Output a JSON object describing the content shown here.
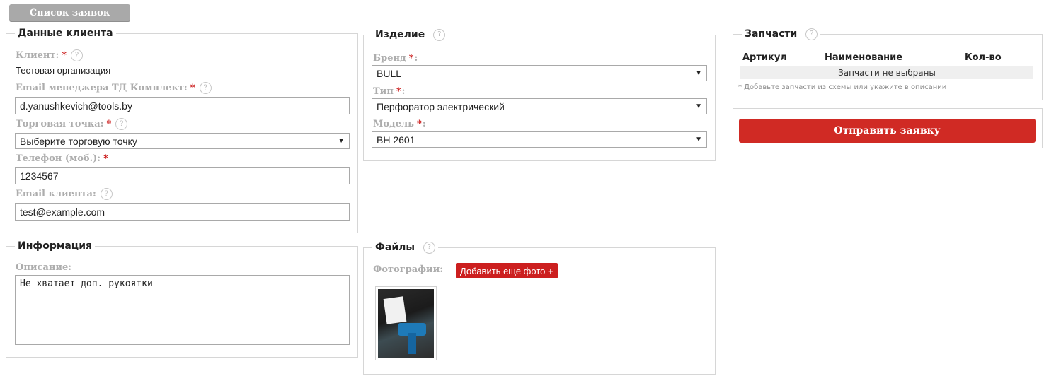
{
  "top_button": "Список заявок",
  "client": {
    "legend": "Данные клиента",
    "client_label": "Клиент:",
    "client_value": "Тестовая организация",
    "manager_email_label": "Email менеджера ТД Комплект:",
    "manager_email_value": "d.yanushkevich@tools.by",
    "point_label": "Торговая точка:",
    "point_value": "Выберите торговую точку",
    "phone_label": "Телефон (моб.):",
    "phone_value": "1234567",
    "client_email_label": "Email клиента:",
    "client_email_value": "test@example.com"
  },
  "product": {
    "legend": "Изделие",
    "brand_label": "Бренд",
    "brand_value": "BULL",
    "type_label": "Тип",
    "type_value": "Перфоратор электрический",
    "model_label": "Модель",
    "model_value": "BH 2601"
  },
  "parts": {
    "legend": "Запчасти",
    "columns": [
      "Артикул",
      "Наименование",
      "Кол-во"
    ],
    "empty_text": "Запчасти не выбраны",
    "note": "* Добавьте запчасти из схемы или укажите в описании"
  },
  "send_button": "Отправить заявку",
  "info": {
    "legend": "Информация",
    "desc_label": "Описание:",
    "desc_value": "Не хватает доп. рукоятки"
  },
  "files": {
    "legend": "Файлы",
    "photos_label": "Фотографии:",
    "add_photo_button": "Добавить еще фото +"
  },
  "symbols": {
    "required": "*",
    "help": "?",
    "dropdown": "▼"
  },
  "colors": {
    "accent_red": "#cc1f1f",
    "button_gray": "#a9a9a9"
  }
}
